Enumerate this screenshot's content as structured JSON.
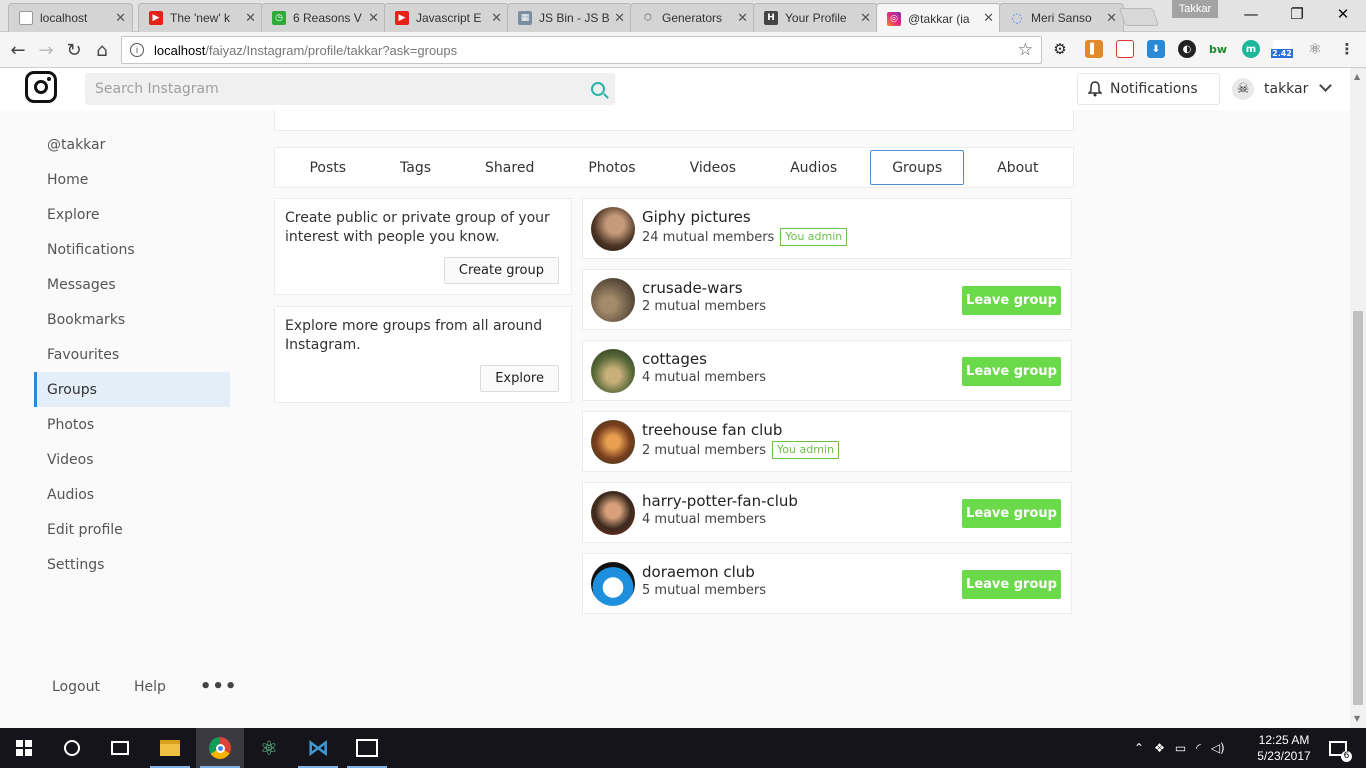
{
  "browser": {
    "tabs": [
      {
        "title": "localhost",
        "favicon_color": "#9e9e9e",
        "glyph": ""
      },
      {
        "title": "The 'new' k",
        "favicon_color": "#e62117",
        "glyph": "▶"
      },
      {
        "title": "6 Reasons V",
        "favicon_color": "#2eaa3a",
        "glyph": "◷"
      },
      {
        "title": "Javascript E",
        "favicon_color": "#e62117",
        "glyph": "▶"
      },
      {
        "title": "JS Bin - JS B",
        "favicon_color": "#7a8da1",
        "glyph": "▦"
      },
      {
        "title": "Generators",
        "favicon_color": "#666666",
        "glyph": "⬡"
      },
      {
        "title": "Your Profile",
        "favicon_color": "#444444",
        "glyph": "H"
      },
      {
        "title": "@takkar (ia",
        "favicon_color": "#c13584",
        "glyph": "◎"
      },
      {
        "title": "Meri Sanso",
        "favicon_color": "#4d90fe",
        "glyph": "◌"
      }
    ],
    "profile_name": "Takkar",
    "url_host": "localhost",
    "url_path": "/faiyaz/Instagram/profile/takkar?ask=groups",
    "extension_badge": "2.42"
  },
  "header": {
    "search_placeholder": "Search Instagram",
    "notifications_label": "Notifications",
    "username": "takkar"
  },
  "sidebar": {
    "items": [
      {
        "label": "@takkar"
      },
      {
        "label": "Home"
      },
      {
        "label": "Explore"
      },
      {
        "label": "Notifications"
      },
      {
        "label": "Messages"
      },
      {
        "label": "Bookmarks"
      },
      {
        "label": "Favourites"
      },
      {
        "label": "Groups",
        "active": true
      },
      {
        "label": "Photos"
      },
      {
        "label": "Videos"
      },
      {
        "label": "Audios"
      },
      {
        "label": "Edit profile"
      },
      {
        "label": "Settings"
      }
    ],
    "footer": {
      "logout": "Logout",
      "help": "Help",
      "more": "•••"
    }
  },
  "profile_tabs": [
    {
      "label": "Posts"
    },
    {
      "label": "Tags"
    },
    {
      "label": "Shared"
    },
    {
      "label": "Photos"
    },
    {
      "label": "Videos"
    },
    {
      "label": "Audios"
    },
    {
      "label": "Groups",
      "active": true
    },
    {
      "label": "About"
    }
  ],
  "cards": {
    "create": {
      "text": "Create public or private group of your interest with people you know.",
      "button": "Create group"
    },
    "explore": {
      "text": "Explore more groups from all around Instagram.",
      "button": "Explore"
    }
  },
  "groups": [
    {
      "name": "Giphy pictures",
      "members": "24 mutual members",
      "admin": "You admin",
      "avatar_color": "#4a3424",
      "leave": ""
    },
    {
      "name": "crusade-wars",
      "members": "2 mutual members",
      "admin": "",
      "avatar_color": "#6b5a46",
      "leave": "Leave group"
    },
    {
      "name": "cottages",
      "members": "4 mutual members",
      "admin": "",
      "avatar_color": "#5a6a3a",
      "leave": "Leave group"
    },
    {
      "name": "treehouse fan club",
      "members": "2 mutual members",
      "admin": "You admin",
      "avatar_color": "#7a3e1e",
      "leave": ""
    },
    {
      "name": "harry-potter-fan-club",
      "members": "4 mutual members",
      "admin": "",
      "avatar_color": "#3a2a1e",
      "leave": "Leave group"
    },
    {
      "name": "doraemon club",
      "members": "5 mutual members",
      "admin": "",
      "avatar_color": "#1e8fdc",
      "leave": "Leave group"
    }
  ],
  "taskbar": {
    "time": "12:25 AM",
    "date": "5/23/2017",
    "notification_count": "6"
  }
}
